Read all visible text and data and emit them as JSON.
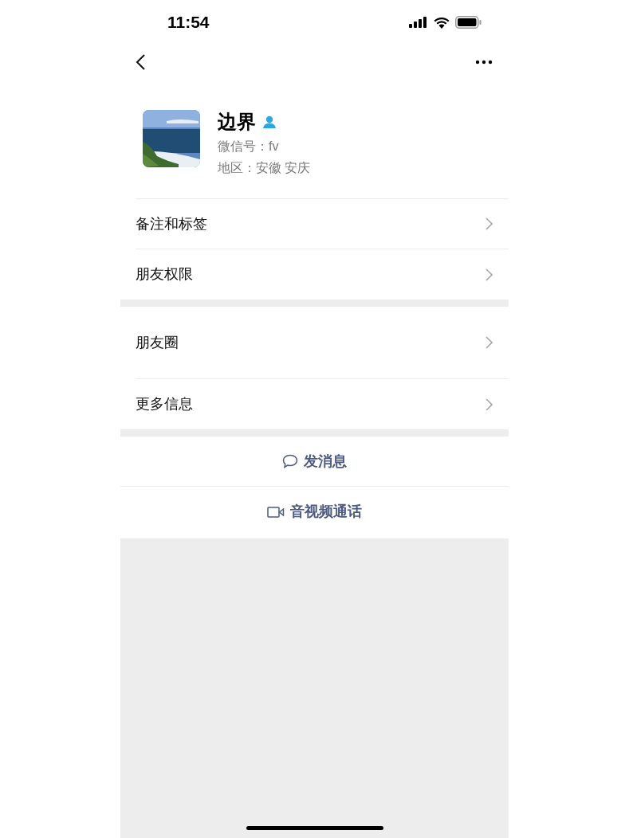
{
  "status_bar": {
    "time": "11:54"
  },
  "profile": {
    "name": "边界",
    "wechat_id": "微信号：fv",
    "region": "地区：安徽 安庆"
  },
  "groups": [
    [
      {
        "label": "备注和标签",
        "kind": "link"
      },
      {
        "label": "朋友权限",
        "kind": "link"
      }
    ],
    [
      {
        "label": "朋友圈",
        "kind": "moments"
      },
      {
        "label": "更多信息",
        "kind": "link"
      }
    ]
  ],
  "actions": [
    {
      "label": "发消息",
      "kind": "chat"
    },
    {
      "label": "音视频通话",
      "kind": "video"
    }
  ]
}
